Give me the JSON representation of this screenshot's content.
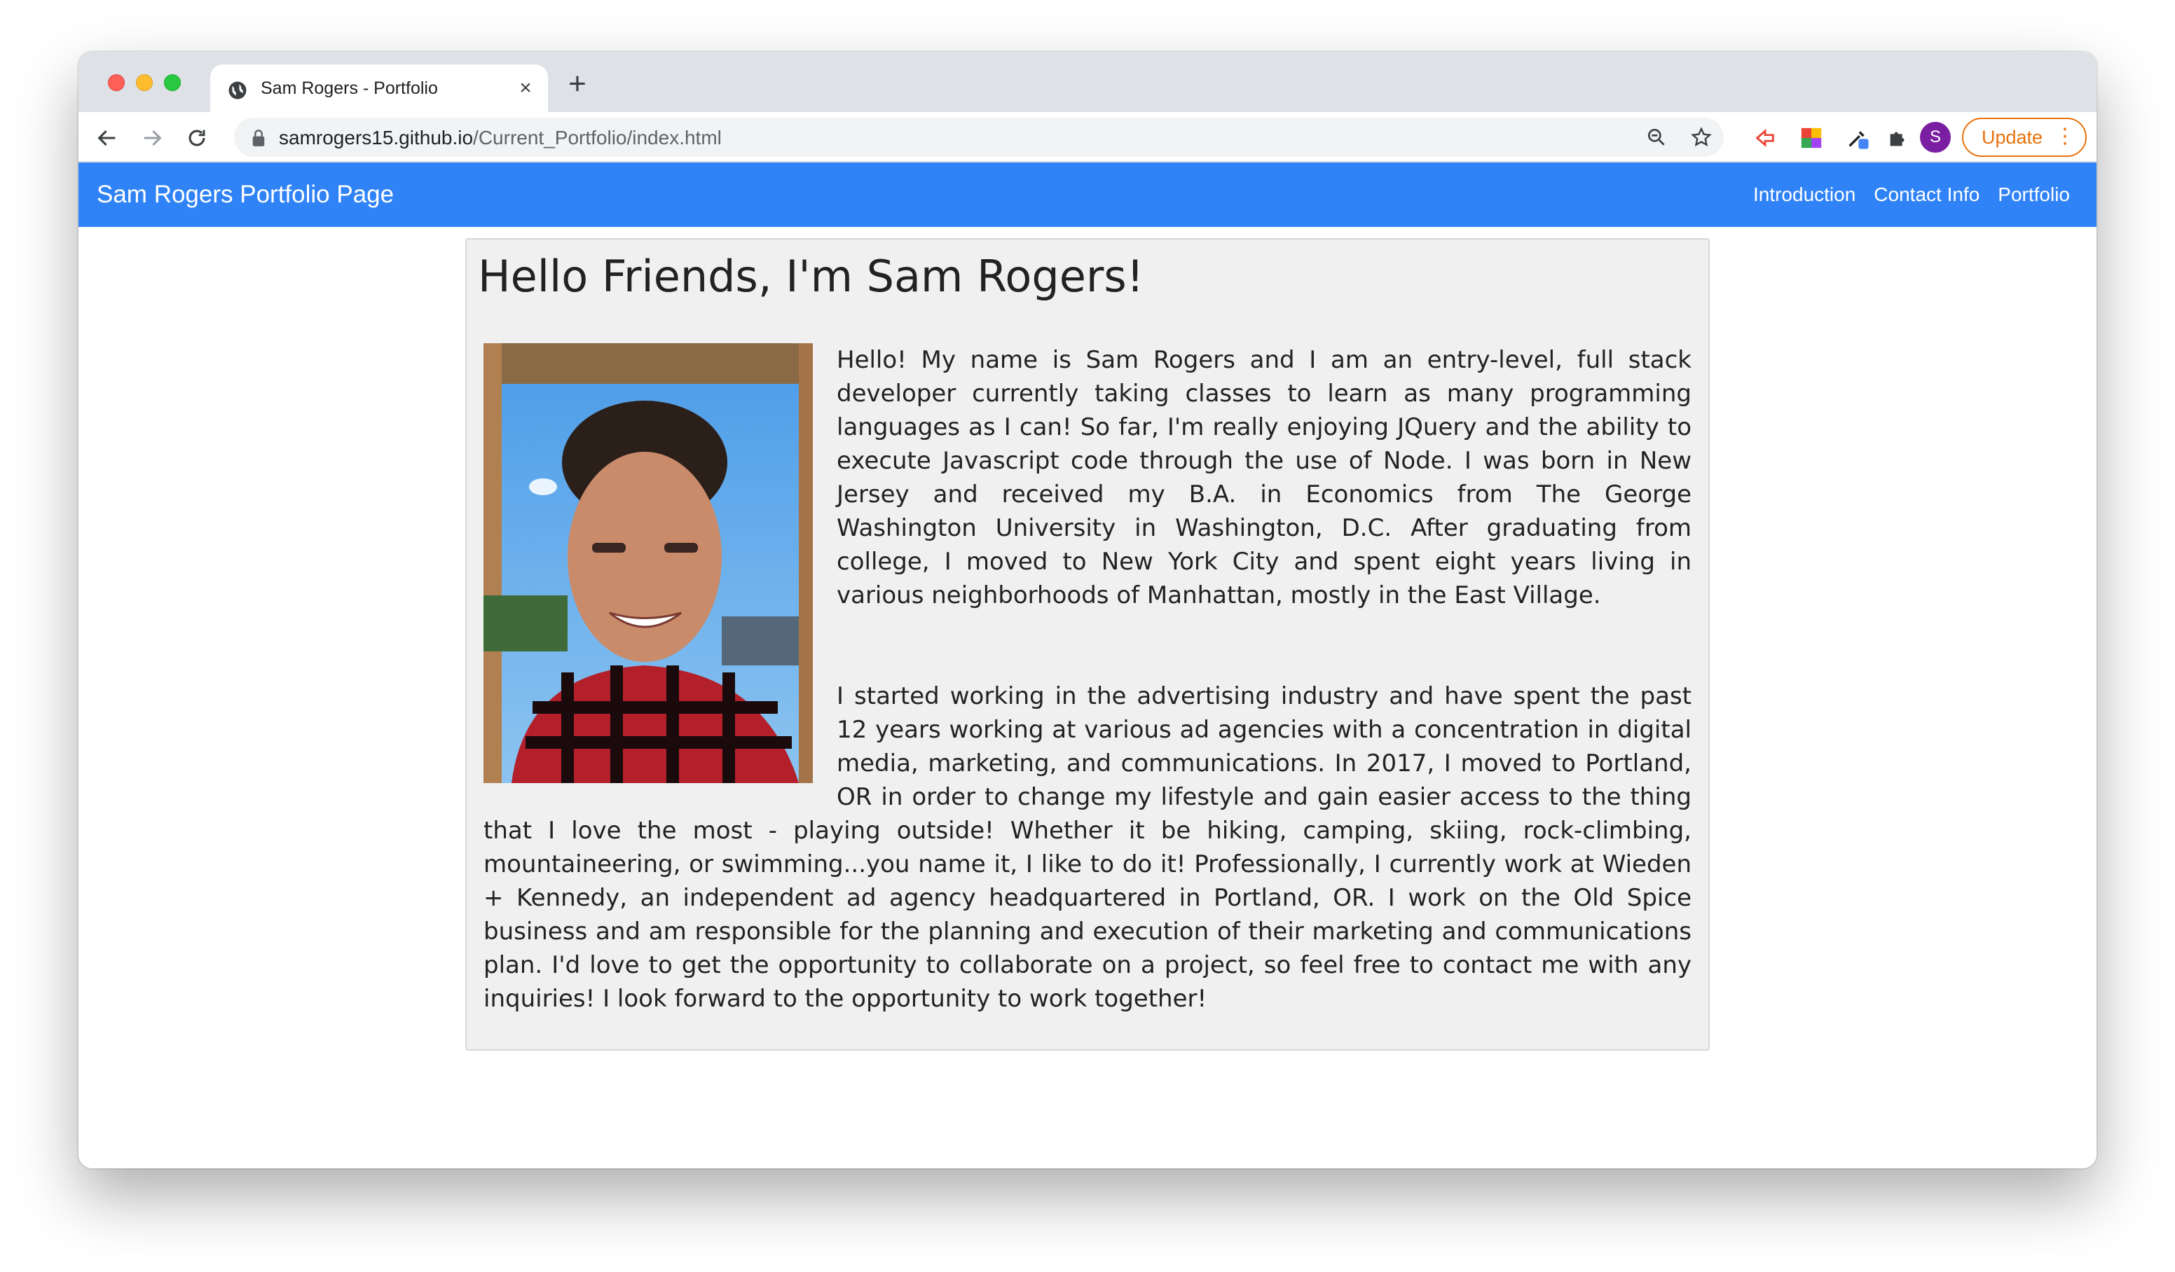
{
  "browser": {
    "tab_title": "Sam Rogers - Portfolio",
    "new_tab_symbol": "+",
    "close_symbol": "×",
    "url_host": "samrogers15.github.io",
    "url_path": "/Current_Portfolio/index.html",
    "profile_initial": "S",
    "update_label": "Update",
    "icons": [
      "back-arrow-icon",
      "forward-arrow-icon",
      "reload-icon",
      "lock-icon",
      "zoom-icon",
      "star-icon",
      "extension-icons",
      "puzzle-icon",
      "kebab-menu-icon"
    ]
  },
  "site": {
    "brand": "Sam Rogers Portfolio Page",
    "nav": [
      "Introduction",
      "Contact Info",
      "Portfolio"
    ],
    "colors": {
      "navbar": "#3083f6",
      "card_bg": "#f0f0f0"
    }
  },
  "content": {
    "heading": "Hello Friends, I'm Sam Rogers!",
    "paragraph1": "Hello! My name is Sam Rogers and I am an entry-level, full stack developer currently taking classes to learn as many programming languages as I can! So far, I'm really enjoying JQuery and the ability to execute Javascript code through the use of Node. I was born in New Jersey and received my B.A. in Economics from The George Washington University in Washington, D.C. After graduating from college, I moved to New York City and spent eight years living in various neighborhoods of Manhattan, mostly in the East Village.",
    "paragraph2": "I started working in the advertising industry and have spent the past 12 years working at various ad agencies with a concentration in digital media, marketing, and communications. In 2017, I moved to Portland, OR in order to change my lifestyle and gain easier access to the thing that I love the most - playing outside! Whether it be hiking, camping, skiing, rock-climbing, mountaineering, or swimming...you name it, I like to do it! Professionally, I currently work at Wieden + Kennedy, an independent ad agency headquartered in Portland, OR. I work on the Old Spice business and am responsible for the planning and execution of their marketing and communications plan. I'd love to get the opportunity to collaborate on a project, so feel free to contact me with any inquiries! I look forward to the opportunity to work together!"
  }
}
